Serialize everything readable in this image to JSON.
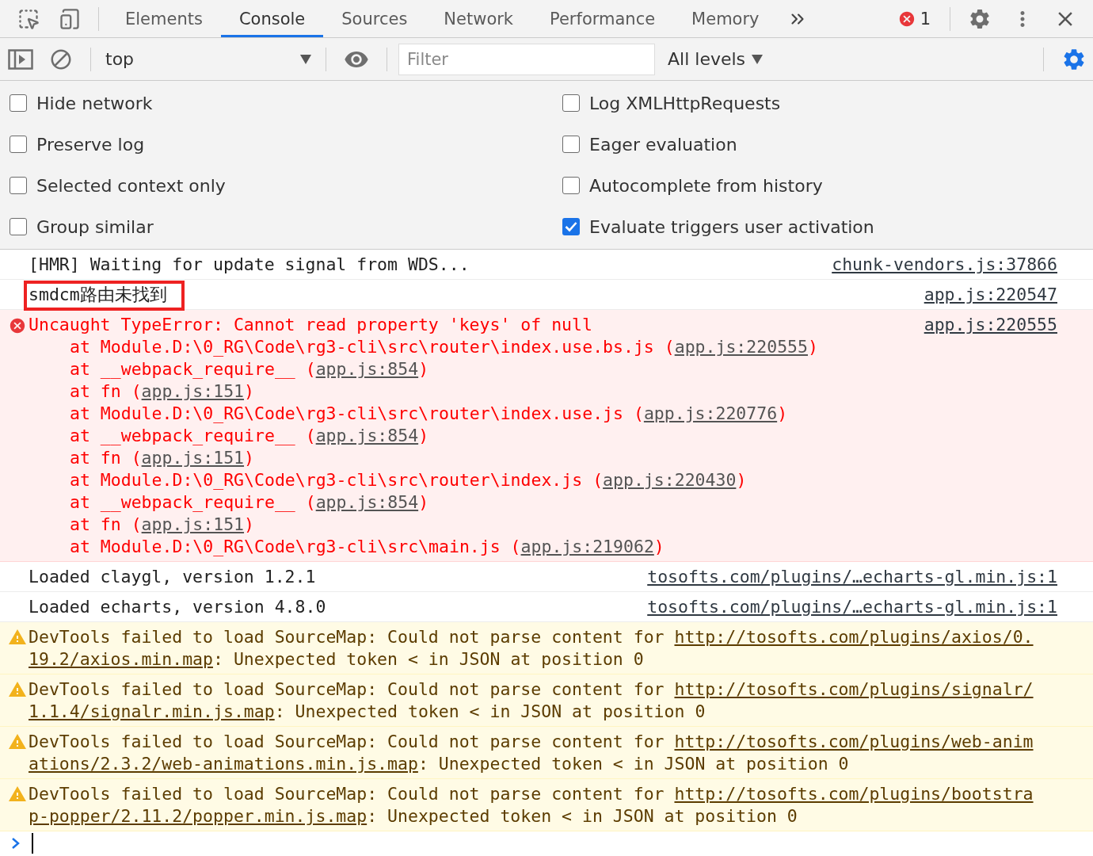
{
  "tabs": [
    {
      "label": "Elements",
      "selected": false
    },
    {
      "label": "Console",
      "selected": true
    },
    {
      "label": "Sources",
      "selected": false
    },
    {
      "label": "Network",
      "selected": false
    },
    {
      "label": "Performance",
      "selected": false
    },
    {
      "label": "Memory",
      "selected": false
    }
  ],
  "error_count": "1",
  "toolbar": {
    "context": "top",
    "filter_placeholder": "Filter",
    "levels": "All levels"
  },
  "settings": [
    {
      "label": "Hide network",
      "checked": false
    },
    {
      "label": "Log XMLHttpRequests",
      "checked": false
    },
    {
      "label": "Preserve log",
      "checked": false
    },
    {
      "label": "Eager evaluation",
      "checked": false
    },
    {
      "label": "Selected context only",
      "checked": false
    },
    {
      "label": "Autocomplete from history",
      "checked": false
    },
    {
      "label": "Group similar",
      "checked": false
    },
    {
      "label": "Evaluate triggers user activation",
      "checked": true
    }
  ],
  "messages": [
    {
      "kind": "log",
      "text": "[HMR] Waiting for update signal from WDS...",
      "source": "chunk-vendors.js:37866"
    },
    {
      "kind": "log",
      "text": "smdcm路由未找到",
      "source": "app.js:220547",
      "highlighted": true
    },
    {
      "kind": "error",
      "text": "Uncaught TypeError: Cannot read property 'keys' of null",
      "source": "app.js:220555",
      "stack": [
        {
          "before": "at Module.D:\\0_RG\\Code\\rg3-cli\\src\\router\\index.use.bs.js (",
          "link": "app.js:220555",
          "after": ")"
        },
        {
          "before": "at __webpack_require__ (",
          "link": "app.js:854",
          "after": ")"
        },
        {
          "before": "at fn (",
          "link": "app.js:151",
          "after": ")"
        },
        {
          "before": "at Module.D:\\0_RG\\Code\\rg3-cli\\src\\router\\index.use.js (",
          "link": "app.js:220776",
          "after": ")"
        },
        {
          "before": "at __webpack_require__ (",
          "link": "app.js:854",
          "after": ")"
        },
        {
          "before": "at fn (",
          "link": "app.js:151",
          "after": ")"
        },
        {
          "before": "at Module.D:\\0_RG\\Code\\rg3-cli\\src\\router\\index.js (",
          "link": "app.js:220430",
          "after": ")"
        },
        {
          "before": "at __webpack_require__ (",
          "link": "app.js:854",
          "after": ")"
        },
        {
          "before": "at fn (",
          "link": "app.js:151",
          "after": ")"
        },
        {
          "before": "at Module.D:\\0_RG\\Code\\rg3-cli\\src\\main.js (",
          "link": "app.js:219062",
          "after": ")"
        }
      ]
    },
    {
      "kind": "log",
      "text": "Loaded claygl, version 1.2.1",
      "source": "tosofts.com/plugins/…echarts-gl.min.js:1"
    },
    {
      "kind": "log",
      "text": "Loaded echarts, version 4.8.0",
      "source": "tosofts.com/plugins/…echarts-gl.min.js:1"
    },
    {
      "kind": "warning",
      "before": "DevTools failed to load SourceMap: Could not parse content for ",
      "link_start": "http://tosofts.com/plugins/axios/0.",
      "link_end": "19.2/axios.min.map",
      "after": ": Unexpected token < in JSON at position 0"
    },
    {
      "kind": "warning",
      "before": "DevTools failed to load SourceMap: Could not parse content for ",
      "link_start": "http://tosofts.com/plugins/signalr/",
      "link_end": "1.1.4/signalr.min.js.map",
      "after": ": Unexpected token < in JSON at position 0"
    },
    {
      "kind": "warning",
      "before": "DevTools failed to load SourceMap: Could not parse content for ",
      "link_start": "http://tosofts.com/plugins/web-anim",
      "link_end": "ations/2.3.2/web-animations.min.js.map",
      "after": ": Unexpected token < in JSON at position 0"
    },
    {
      "kind": "warning",
      "before": "DevTools failed to load SourceMap: Could not parse content for ",
      "link_start": "http://tosofts.com/plugins/bootstra",
      "link_end": "p-popper/2.11.2/popper.min.js.map",
      "after": ": Unexpected token < in JSON at position 0"
    }
  ]
}
